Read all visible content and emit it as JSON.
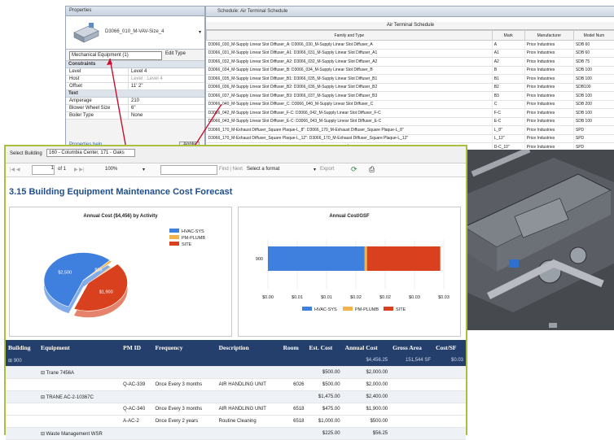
{
  "properties": {
    "title": "Properties",
    "type_name": "D3066_010_M-VAV-Size_4",
    "filter": "Mechanical Equipment (1)",
    "edit_type": "Edit Type",
    "groups": [
      {
        "name": "Constraints",
        "rows": [
          {
            "k": "Level",
            "v": "Level 4",
            "grey": false
          },
          {
            "k": "Host",
            "v": "Level : Level 4",
            "grey": true
          },
          {
            "k": "Offset",
            "v": "11' 2\"",
            "grey": false
          }
        ]
      },
      {
        "name": "Text",
        "rows": [
          {
            "k": "Amperage",
            "v": "210",
            "grey": false
          },
          {
            "k": "Blower Wheel Size",
            "v": "6\"",
            "grey": false
          },
          {
            "k": "Boiler Type",
            "v": "None",
            "grey": false
          }
        ]
      }
    ],
    "help": "Properties help",
    "apply": "Apply"
  },
  "schedule": {
    "title": "Schedule: Air Terminal Schedule",
    "grid_title": "Air Terminal Schedule",
    "columns": [
      "Family and Type",
      "Mark",
      "Manufacturer",
      "Model Num"
    ],
    "rows": [
      [
        "D3066_030_M-Supply Linear Slot Diffuser_A: D3066_030_M-Supply Linear Slot Diffuser_A",
        "A",
        "Price Industries",
        "SDB 60"
      ],
      [
        "D3066_031_M-Supply Linear Slot Diffuser_A1: D3066_031_M-Supply Linear Slot Diffuser_A1",
        "A1",
        "Price Industries",
        "SDB 60"
      ],
      [
        "D3066_032_M-Supply Linear Slot Diffuser_A2: D3066_032_M-Supply Linear Slot Diffuser_A2",
        "A2",
        "Price Industries",
        "SDB 75"
      ],
      [
        "D3066_034_M-Supply Linear Slot Diffuser_B: D3066_034_M-Supply Linear Slot Diffuser_B",
        "B",
        "Price Industries",
        "SDB 100"
      ],
      [
        "D3066_035_M-Supply Linear Slot Diffuser_B1: D3066_035_M-Supply Linear Slot Diffuser_B1",
        "B1",
        "Price Industries",
        "SDB 100"
      ],
      [
        "D3066_036_M-Supply Linear Slot Diffuser_B2: D3066_036_M-Supply Linear Slot Diffuser_B2",
        "B2",
        "Price Industries",
        "SDB100"
      ],
      [
        "D3066_037_M-Supply Linear Slot Diffuser_B3: D3066_037_M-Supply Linear Slot Diffuser_B3",
        "B3",
        "Price Industries",
        "SDB 100"
      ],
      [
        "D3066_040_M-Supply Linear Slot Diffuser_C: D3066_040_M-Supply Linear Slot Diffuser_C",
        "C",
        "Price Industries",
        "SDB 200"
      ],
      [
        "D3066_042_M-Supply Linear Slot Diffuser_F-C: D3066_042_M-Supply Linear Slot Diffuser_F-C",
        "F-C",
        "Price Industries",
        "SDB 100"
      ],
      [
        "D3066_043_M-Supply Linear Slot Diffuser_E-C: D3066_043_M-Supply Linear Slot Diffuser_E-C",
        "E-C",
        "Price Industries",
        "SDB 100"
      ],
      [
        "D3066_170_M-Exhaust Diffuser_Square Plaque-L_8\": D3066_170_M-Exhaust Diffuser_Square Plaque-L_8\"",
        "L_8\"",
        "Price Industries",
        "SPD"
      ],
      [
        "D3066_170_M-Exhaust Diffuser_Square Plaque-L_12\": D3066_170_M-Exhaust Diffuser_Square Plaque-L_12\"",
        "L_12\"",
        "Price Industries",
        "SPD"
      ],
      [
        "D3066_180_M-Exhaust Diffuser_Square Plaque-D-C_10\": D3066_180_M-Exhaust Diffuser_Square Plaque-D-C_10\"",
        "D-C_10\"",
        "Price Industries",
        "SPD"
      ]
    ]
  },
  "report": {
    "select_label": "Select Building",
    "building": "160 - Columbia Center, 171 - Oaks",
    "page": "1",
    "of_pages": "of 1",
    "zoom": "100%",
    "find_next": "Find | Next",
    "format": "Select a format",
    "export": "Export",
    "title": "3.15 Building Equipment Maintenance Cost Forecast",
    "colors": {
      "hvac": "#3f7fdd",
      "plumb": "#f2b34a",
      "site": "#d9411e",
      "header": "#243f6c",
      "title": "#1f4e8c"
    },
    "columns": [
      "Building",
      "Equipment",
      "PM ID",
      "Frequency",
      "Description",
      "Room",
      "Est. Cost",
      "Annual Cost",
      "Gross Area",
      "Cost/SF"
    ],
    "rows": [
      {
        "lvl": 0,
        "cells": [
          "⊞ 900",
          "",
          "",
          "",
          "",
          "",
          "",
          "$4,456.25",
          "151,544 SF",
          "$0.03"
        ]
      },
      {
        "lvl": 1,
        "cells": [
          "",
          "⊟ Trane 7456A",
          "",
          "",
          "",
          "",
          "$500.00",
          "$2,000.00",
          "",
          ""
        ]
      },
      {
        "lvl": 2,
        "cells": [
          "",
          "",
          "Q-AC-339",
          "Once Every 3 months",
          "AIR HANDLING UNIT",
          "6026",
          "$500.00",
          "$2,000.00",
          "",
          ""
        ]
      },
      {
        "lvl": 1,
        "cells": [
          "",
          "⊟ TRANE AC-2-10367C",
          "",
          "",
          "",
          "",
          "$1,475.00",
          "$2,400.00",
          "",
          ""
        ]
      },
      {
        "lvl": 2,
        "cells": [
          "",
          "",
          "Q-AC-340",
          "Once Every 3 months",
          "AIR HANDLING UNIT",
          "6518",
          "$475.00",
          "$1,900.00",
          "",
          ""
        ]
      },
      {
        "lvl": 2,
        "cells": [
          "",
          "",
          "A-AC-2",
          "Once Every 2 years",
          "Routine Cleaning",
          "6518",
          "$1,000.00",
          "$500.00",
          "",
          ""
        ]
      },
      {
        "lvl": 1,
        "cells": [
          "",
          "⊟ Waste Management WSR",
          "",
          "",
          "",
          "",
          "$225.00",
          "$56.25",
          "",
          ""
        ]
      }
    ]
  },
  "chart_data": [
    {
      "type": "pie",
      "title": "Annual Cost ($4,456) by Activity",
      "labels": [
        "HVAC-SYS",
        "PM-PLUMB",
        "SITE"
      ],
      "values": [
        2500,
        56,
        1900
      ],
      "data_labels": [
        "$2,500",
        "$56",
        "$1,900"
      ],
      "colors": [
        "#3f7fdd",
        "#f2b34a",
        "#d9411e"
      ],
      "legend": "top-right"
    },
    {
      "type": "bar",
      "orientation": "horizontal",
      "stacked": true,
      "title": "Annual Cost/GSF",
      "categories": [
        "900"
      ],
      "series": [
        {
          "name": "HVAC-SYS",
          "values": [
            0.0165
          ]
        },
        {
          "name": "PM-PLUMB",
          "values": [
            0.0004
          ]
        },
        {
          "name": "SITE",
          "values": [
            0.0125
          ]
        }
      ],
      "xticks": [
        "$0.00",
        "$0.01",
        "$0.01",
        "$0.02",
        "$0.02",
        "$0.03",
        "$0.03"
      ],
      "xlim": [
        0,
        0.03
      ],
      "colors": [
        "#3f7fdd",
        "#f2b34a",
        "#d9411e"
      ],
      "legend": "bottom"
    }
  ]
}
